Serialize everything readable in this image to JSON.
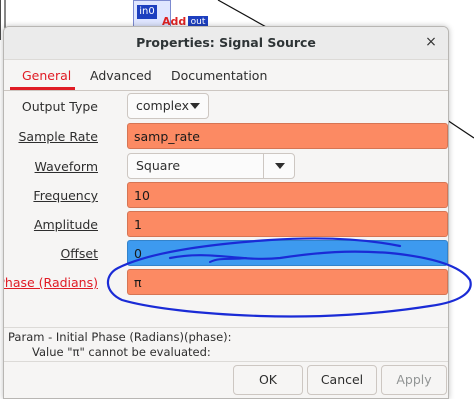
{
  "background": {
    "port_in_label": "in0",
    "block_label": "Add",
    "port_out_label": "out"
  },
  "dialog": {
    "title": "Properties: Signal Source",
    "close_glyph": "×"
  },
  "tabs": [
    {
      "label": "General",
      "active": true
    },
    {
      "label": "Advanced",
      "active": false
    },
    {
      "label": "Documentation",
      "active": false
    }
  ],
  "params": {
    "output_type": {
      "label": "Output Type",
      "value": "complex"
    },
    "sample_rate": {
      "label": "Sample Rate",
      "value": "samp_rate"
    },
    "waveform": {
      "label": "Waveform",
      "value": "Square"
    },
    "frequency": {
      "label": "Frequency",
      "value": "10"
    },
    "amplitude": {
      "label": "Amplitude",
      "value": "1"
    },
    "offset": {
      "label": "Offset",
      "value": "0"
    },
    "initial_phase": {
      "label": "Initial Phase (Radians)",
      "value": "π"
    }
  },
  "status": {
    "line1": "Param - Initial Phase (Radians)(phase):",
    "line2": "Value \"π\" cannot be evaluated:"
  },
  "buttons": {
    "ok": "OK",
    "cancel": "Cancel",
    "apply": "Apply"
  },
  "colors": {
    "error_field": "#fc8a63",
    "focused_field": "#3d9aef",
    "active_tab": "#e01b24",
    "annotation_ink": "#1a2bd6"
  }
}
